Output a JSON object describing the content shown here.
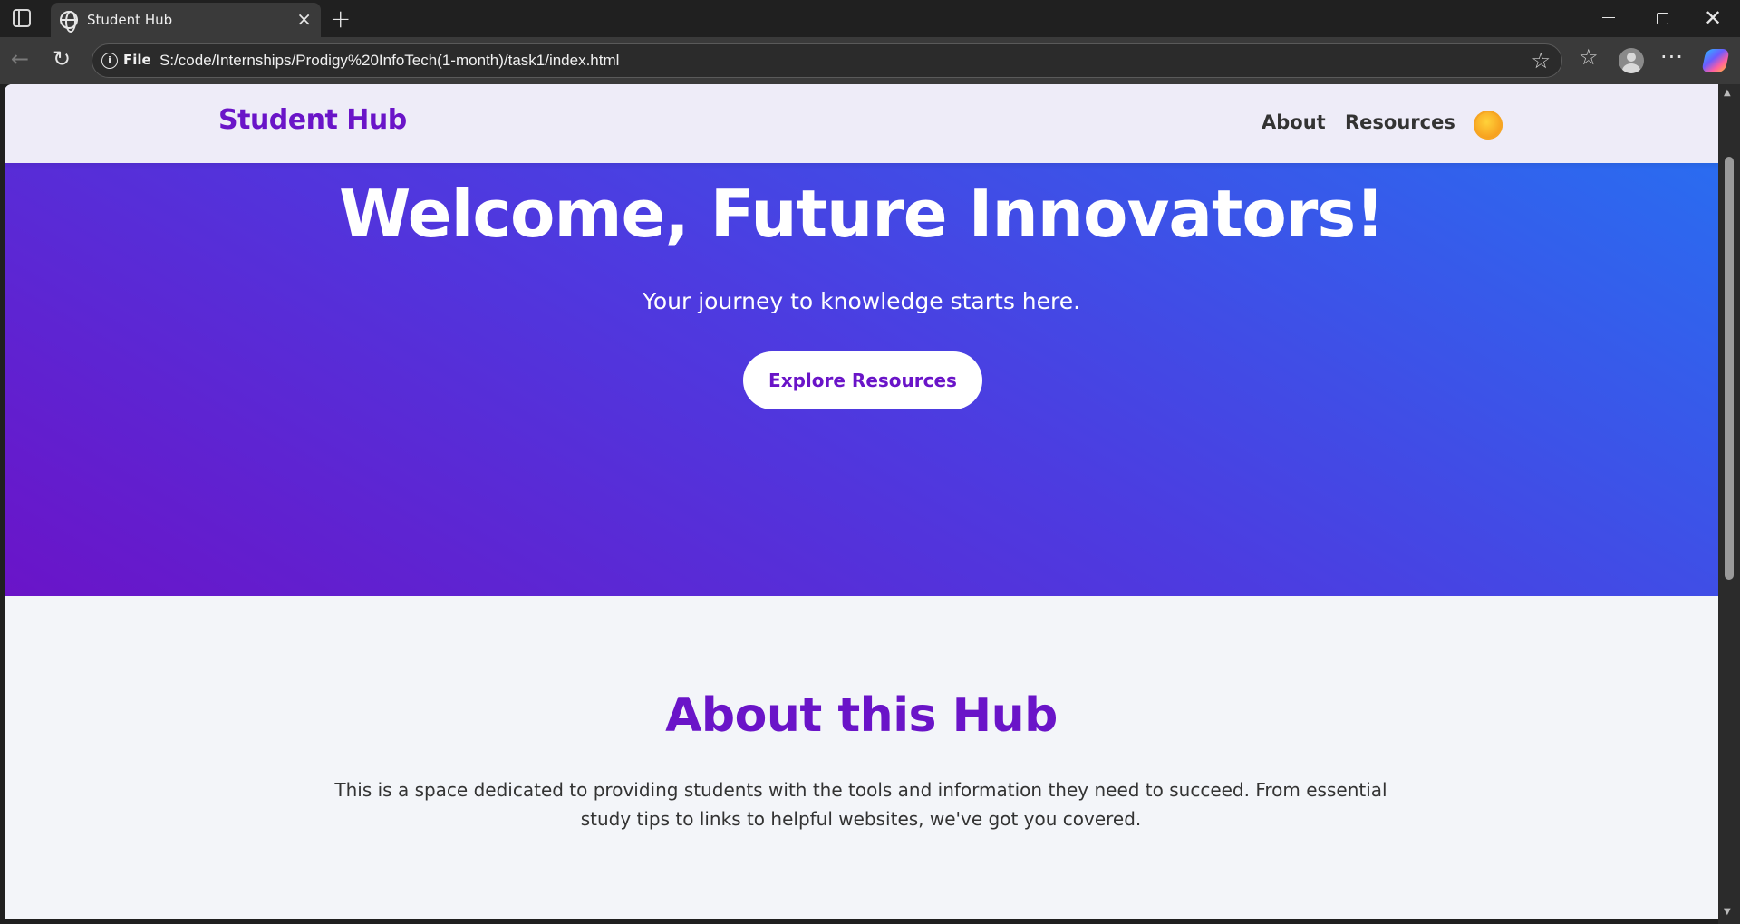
{
  "browser": {
    "tab_title": "Student Hub",
    "address_prefix": "File",
    "url": "S:/code/Internships/Prodigy%20InfoTech(1-month)/task1/index.html"
  },
  "site": {
    "logo": "Student Hub",
    "nav": [
      {
        "label": "About"
      },
      {
        "label": "Resources"
      }
    ],
    "theme_icon": "sun-icon",
    "accent_color": "#6a14c8"
  },
  "hero": {
    "title": "Welcome, Future Innovators!",
    "subtitle": "Your journey to knowledge starts here.",
    "cta_label": "Explore Resources",
    "gradient_start": "#6a14c8",
    "gradient_end": "#2a6cf0"
  },
  "about": {
    "title": "About this Hub",
    "text": "This is a space dedicated to providing students with the tools and information they need to succeed. From essential study tips to links to helpful websites, we've got you covered."
  }
}
